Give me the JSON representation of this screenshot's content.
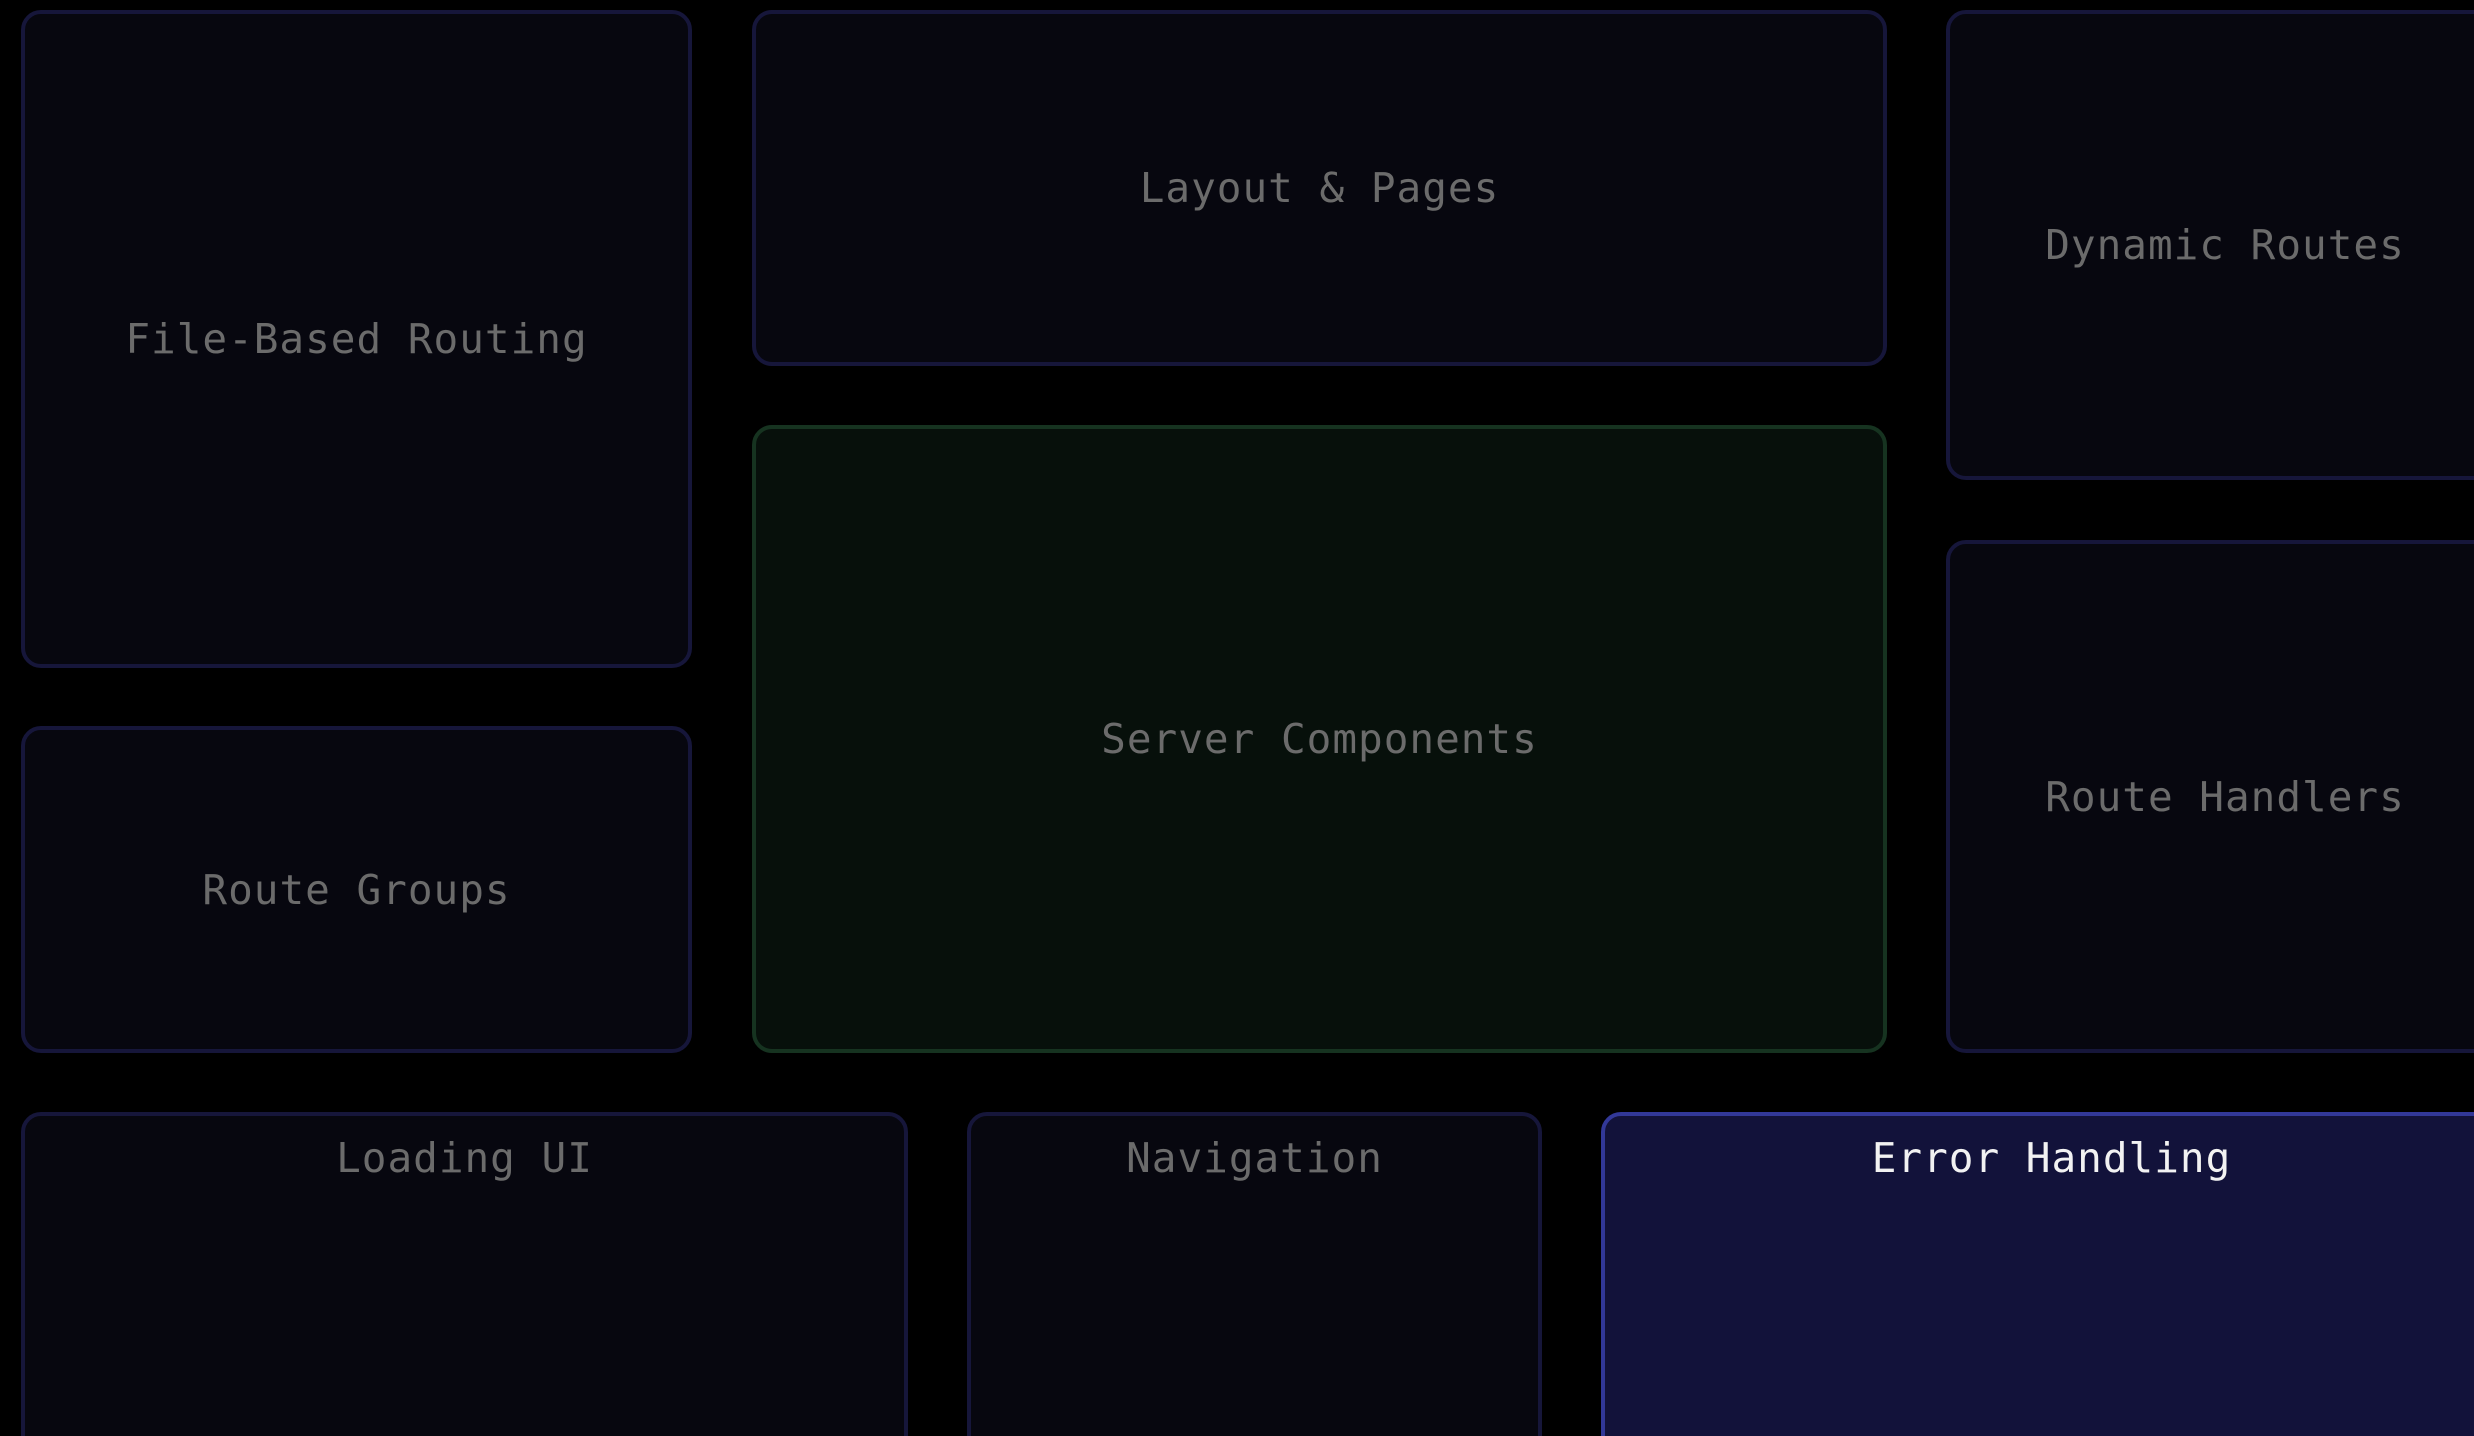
{
  "tiles": [
    {
      "id": "file-routing",
      "label": "File-Based Routing",
      "state": "default"
    },
    {
      "id": "layout-pages",
      "label": "Layout & Pages",
      "state": "default"
    },
    {
      "id": "dynamic-routes",
      "label": "Dynamic Routes",
      "state": "default"
    },
    {
      "id": "server-components",
      "label": "Server Components",
      "state": "highlighted"
    },
    {
      "id": "route-groups",
      "label": "Route Groups",
      "state": "default"
    },
    {
      "id": "route-handlers",
      "label": "Route Handlers",
      "state": "default"
    },
    {
      "id": "loading-ui",
      "label": "Loading UI",
      "state": "default"
    },
    {
      "id": "navigation",
      "label": "Navigation",
      "state": "default"
    },
    {
      "id": "error-handling",
      "label": "Error Handling",
      "state": "selected"
    }
  ],
  "colors": {
    "background": "#000000",
    "tile_bg": "#07070f",
    "tile_border": "#16163a",
    "tile_text": "#6b6b6b",
    "highlight_bg": "#07100b",
    "highlight_border": "#163320",
    "selected_bg": "#12123a",
    "selected_border": "#323898",
    "selected_text": "#f2f2f2"
  }
}
